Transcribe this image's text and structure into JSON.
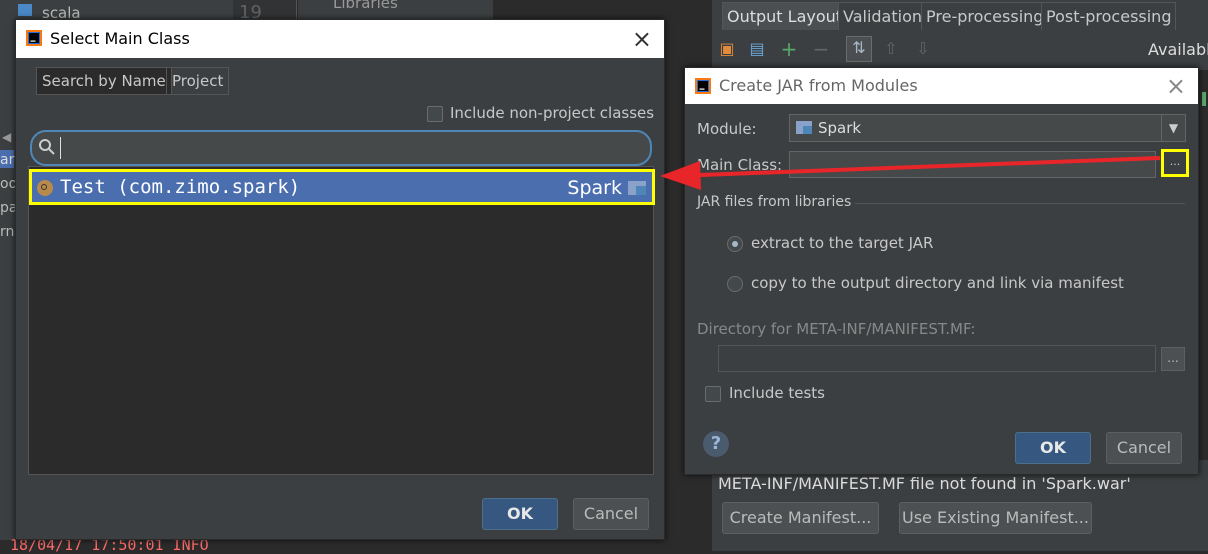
{
  "background": {
    "project_tree_item": "scala",
    "line_number": "19",
    "libraries_label": "Libraries",
    "left_fragments": [
      "ard",
      "oor",
      "pa",
      "rna"
    ],
    "console_line": "18/04/17 17:50:01 INFO",
    "artifact_tabs": [
      "Output Layout",
      "Validation",
      "Pre-processing",
      "Post-processing"
    ],
    "available_label": "Available",
    "manifest_warning": "META-INF/MANIFEST.MF file not found in 'Spark.war'",
    "create_manifest": "Create Manifest...",
    "use_existing_manifest": "Use Existing Manifest..."
  },
  "select_main_class": {
    "title": "Select Main Class",
    "tabs": [
      "Search by Name",
      "Project"
    ],
    "include_non_project": "Include non-project classes",
    "search_value": "",
    "results": [
      {
        "class": "Test (com.zimo.spark)",
        "module": "Spark"
      }
    ],
    "ok": "OK",
    "cancel": "Cancel"
  },
  "create_jar": {
    "title": "Create JAR from Modules",
    "module_label": "Module:",
    "module_value": "Spark",
    "main_class_label": "Main Class:",
    "main_class_value": "",
    "browse": "...",
    "libraries_section": "JAR files from libraries",
    "option_extract": "extract to the target JAR",
    "option_copy": "copy to the output directory and link via manifest",
    "selected_option": "extract",
    "manifest_dir_label": "Directory for META-INF/MANIFEST.MF:",
    "manifest_dir_value": "",
    "include_tests": "Include tests",
    "help": "?",
    "ok": "OK",
    "cancel": "Cancel"
  },
  "colors": {
    "highlight": "#ffff00",
    "arrow": "#e8262a",
    "selection": "#4b6eaf",
    "primary_button": "#365880"
  }
}
